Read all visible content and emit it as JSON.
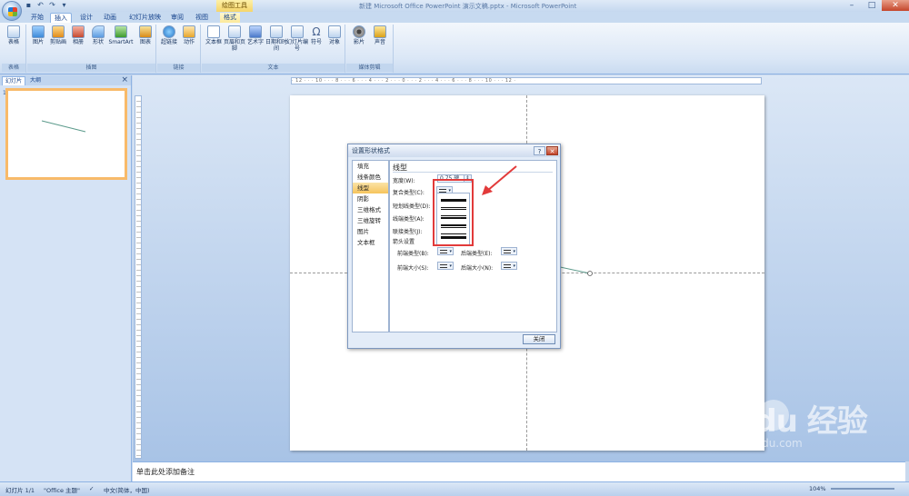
{
  "window": {
    "title": "新建 Microsoft Office PowerPoint 演示文稿.pptx - Microsoft PowerPoint",
    "contextual_group": "绘图工具",
    "controls": [
      "–",
      "□",
      "✕"
    ]
  },
  "tabs": [
    {
      "label": "开始"
    },
    {
      "label": "插入"
    },
    {
      "label": "设计"
    },
    {
      "label": "动画"
    },
    {
      "label": "幻灯片放映"
    },
    {
      "label": "审阅"
    },
    {
      "label": "视图"
    },
    {
      "label": "格式"
    }
  ],
  "ribbon": {
    "groups": [
      {
        "label": "表格",
        "buttons": [
          {
            "label": "表格"
          }
        ]
      },
      {
        "label": "插图",
        "buttons": [
          {
            "label": "图片"
          },
          {
            "label": "剪贴画"
          },
          {
            "label": "相册"
          },
          {
            "label": "形状"
          },
          {
            "label": "SmartArt"
          },
          {
            "label": "图表"
          }
        ]
      },
      {
        "label": "链接",
        "buttons": [
          {
            "label": "超链接"
          },
          {
            "label": "动作"
          }
        ]
      },
      {
        "label": "文本",
        "buttons": [
          {
            "label": "文本框"
          },
          {
            "label": "页眉和页脚"
          },
          {
            "label": "艺术字"
          },
          {
            "label": "日期和时间"
          },
          {
            "label": "幻灯片编号"
          },
          {
            "label": "符号"
          },
          {
            "label": "对象"
          }
        ]
      },
      {
        "label": "媒体剪辑",
        "buttons": [
          {
            "label": "影片"
          },
          {
            "label": "声音"
          }
        ]
      }
    ]
  },
  "left_panel": {
    "tabs": [
      "幻灯片",
      "大纲"
    ],
    "slide_number": "1"
  },
  "ruler_text": "· 12 · · · 10 · · · 8 · · · 6 · · · 4 · · · 2 · · · 0 · · · 2 · · · 4 · · · 6 · · · 8 · · · 10 · · · 12 ·",
  "dialog": {
    "title": "设置形状格式",
    "title_buttons": [
      "?",
      "✕"
    ],
    "nav": [
      "填充",
      "线条颜色",
      "线型",
      "阴影",
      "三维格式",
      "三维旋转",
      "图片",
      "文本框"
    ],
    "active_nav": "线型",
    "section_title": "线型",
    "fields": {
      "width_label": "宽度(W):",
      "width_value": "0.75 磅",
      "compound_label": "复合类型(C):",
      "dash_label": "短划线类型(D):",
      "cap_label": "线端类型(A):",
      "join_label": "联接类型(J):",
      "arrow_label": "箭头设置",
      "begin_type_label": "前端类型(B):",
      "end_type_label": "后端类型(E):",
      "begin_size_label": "前端大小(S):",
      "end_size_label": "后端大小(N):"
    },
    "close_label": "关闭"
  },
  "notes_placeholder": "单击此处添加备注",
  "status": {
    "slide": "幻灯片 1/1",
    "theme": "\"Office 主题\"",
    "language": "中文(简体，中国)",
    "zoom": "104%"
  },
  "watermark": {
    "brand": "Bai du 经验",
    "url": "jingyan.baidu.com"
  }
}
